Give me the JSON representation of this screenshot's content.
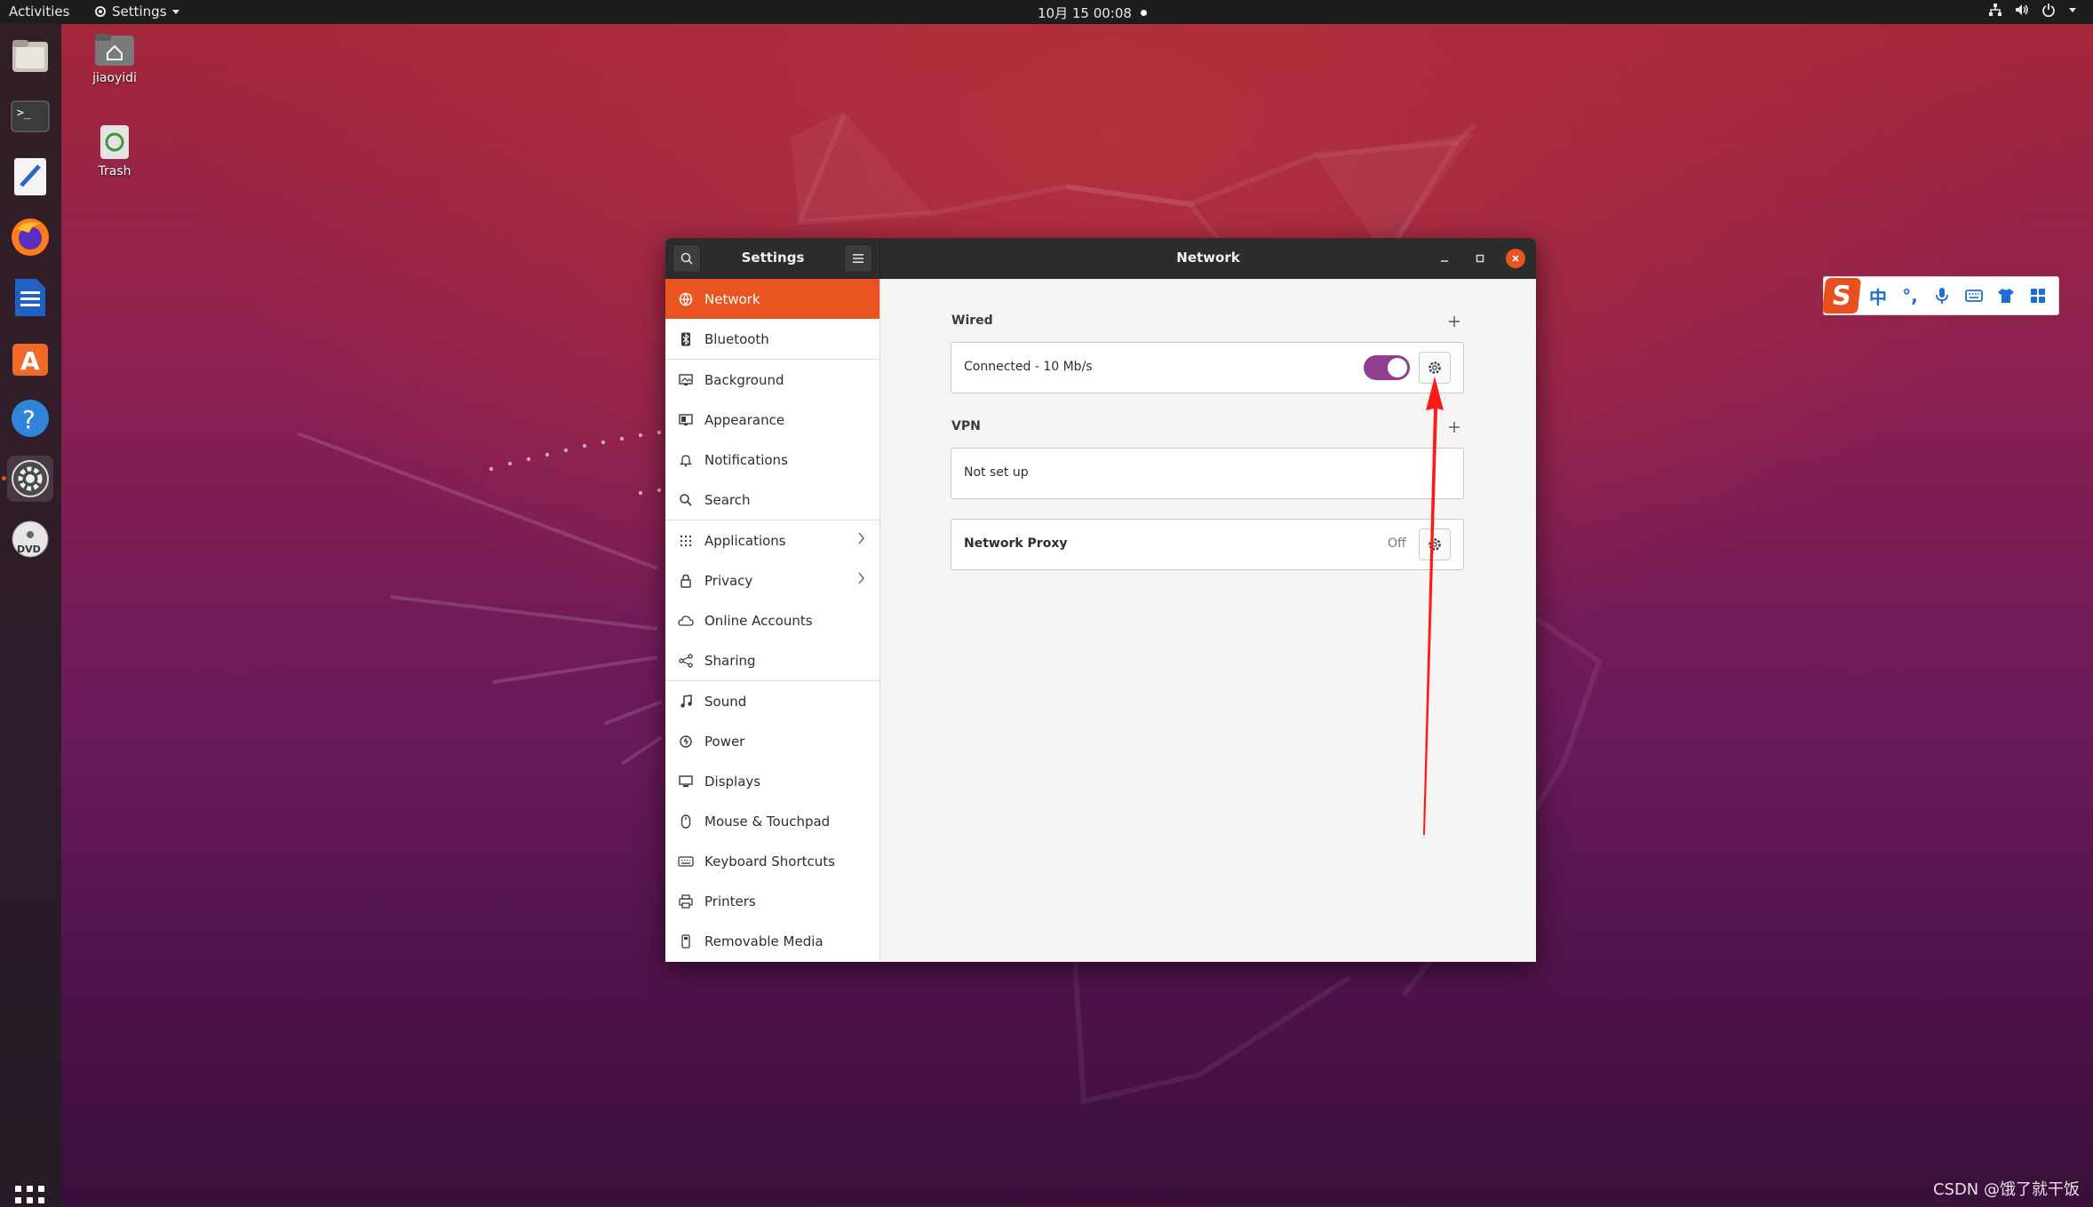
{
  "topbar": {
    "activities": "Activities",
    "app_menu": "Settings",
    "clock": "10月 15  00:08"
  },
  "desktop": {
    "home_label": "jiaoyidi",
    "trash_label": "Trash"
  },
  "window": {
    "sidebar_title": "Settings",
    "main_title": "Network"
  },
  "sidebar": {
    "items": [
      {
        "label": "Network",
        "icon": "network-icon"
      },
      {
        "label": "Bluetooth",
        "icon": "bluetooth-icon"
      },
      {
        "label": "Background",
        "icon": "background-icon"
      },
      {
        "label": "Appearance",
        "icon": "appearance-icon"
      },
      {
        "label": "Notifications",
        "icon": "bell-icon"
      },
      {
        "label": "Search",
        "icon": "search-icon"
      },
      {
        "label": "Applications",
        "icon": "grid-icon"
      },
      {
        "label": "Privacy",
        "icon": "lock-icon"
      },
      {
        "label": "Online Accounts",
        "icon": "cloud-icon"
      },
      {
        "label": "Sharing",
        "icon": "share-icon"
      },
      {
        "label": "Sound",
        "icon": "music-note-icon"
      },
      {
        "label": "Power",
        "icon": "power-icon"
      },
      {
        "label": "Displays",
        "icon": "display-icon"
      },
      {
        "label": "Mouse & Touchpad",
        "icon": "mouse-icon"
      },
      {
        "label": "Keyboard Shortcuts",
        "icon": "keyboard-icon"
      },
      {
        "label": "Printers",
        "icon": "printer-icon"
      },
      {
        "label": "Removable Media",
        "icon": "usb-icon"
      }
    ]
  },
  "network": {
    "wired_title": "Wired",
    "wired_status": "Connected - 10 Mb/s",
    "vpn_title": "VPN",
    "vpn_status": "Not set up",
    "proxy_label": "Network Proxy",
    "proxy_value": "Off"
  },
  "colors": {
    "accent": "#e95420",
    "toggle_on": "#8f3f8c",
    "annotation_arrow": "#ff1a1a"
  },
  "watermark": "CSDN @饿了就干饭"
}
